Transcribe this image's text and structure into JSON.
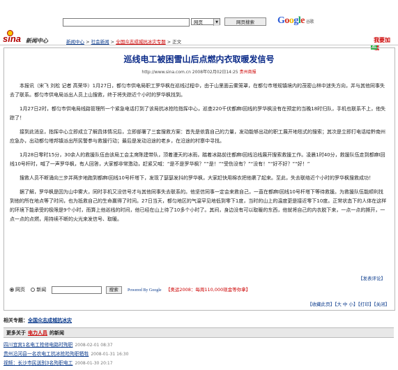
{
  "search": {
    "input_value": "",
    "select_value": "网页",
    "button_label": "网页搜索",
    "google_sub": "谷歌"
  },
  "nav": {
    "logo": "sina",
    "news_center": "新闻中心",
    "breadcrumb": [
      "新闻中心",
      "社会新闻",
      "全国众志成城抗冰灾专题",
      "正文"
    ],
    "collect_label": "我要加载"
  },
  "article": {
    "headline": "巡线电工被困雪山后点燃内衣取暖发信号",
    "url": "http://www.sina.com.cn",
    "datetime": "2008年02月02日14:25",
    "source": "贵州商报",
    "paragraphs": [
      "本报讯（宋飞 刘松 记者 高荣华）1月27日，都匀市供电局职工罗华枫在巡线过程中，由于山里面云雾笼罩，在都匀市塔规镇境内的茂密山林中迷失方向，并与其他同事失去了联系。都匀市供电局派出人员上山搜救，终于将失踪近个小时的罗华枫找到。",
      "1月27日2时，都匀市供电局线路管理所一个紧急电话打到了该局抗冰抢险指挥中心，巡查220千伏都麻Ⅰ回线的罗华枫没有在预定的当晚18时归队，手机也联系不上，他失踪了！",
      "接到此消息，指挥中心立即成立了解具体情况后，立即部署了三套搜救方案：首先是依靠自己的力量，发动能够出动的职工展开地毯式的搜索；其次是立即打电话给黔南州应急办，出动都匀塔邦镇派出所民警参与救援行动；最后是发动沿途的老乡，在沿途的村寨中寻找。",
      "1月28日零时15分，30余人的救援队伍由该局工会主席陈建带队，顶着漫天的冰雨，踏着冰路前往都麻Ⅰ回线沿线展开搜索救援工作。凌晨1时40分，救援队伍走到都麻Ⅰ回线10号杆时，喊了一声罗华枫，有人回答，大家都非常激动，赶紧又喊：“是不是罗华枫？”“是！”“受伤没有？”“没有！”“好不好？”“好！”",
      "搜救人员不断涌向三步并两步地跑到都麻Ⅰ回线10号杆塔下，发现了瑟瑟发抖的罗华枫，大家赶快用棉衣把他裹了起来。至此，失去联络近个小时的罗华枫搜救成功！",
      "据了解，罗华枫是因为山中雾大，同时手机又没信号才与其他同事失去联系的。他坚信同事一定会来救自己，一直在都麻Ⅰ回线10号杆塔下等待救援。为救援队伍能顺利找到他的所在地点等了时间，也为抵救自己的生命赢得了时间。27日当天，都匀地区的气温罕见地低到零下1度，当时的山上的温度更是接近零下10度。正常状态下的人体在这样的环境下能承受的极限是9个小时，而算上他巡线的时间，他已经在山上待了10多个小时了。其间，身边没有可以取暖的东西，他就将自己的内衣脱下来，一点一点的撕开，一点一点的点燃，用持续不断的火光来发信号、取暖。"
    ],
    "discuss": "【发表评论】"
  },
  "bottom": {
    "radio_web": "网页",
    "radio_news": "新闻",
    "search_button": "搜索",
    "powered": "Powered By Google",
    "promo": "【奥运2008：每周110,000现金等你拿】",
    "tools": [
      "收藏此页",
      "大",
      "中",
      "小",
      "打印",
      "关闭"
    ]
  },
  "related": {
    "label": "相关专题：",
    "topic": "全国众志成城抗冰灾",
    "more_prefix": "更多关于",
    "more_keyword": "电力人员",
    "more_suffix": "的新闻",
    "items": [
      {
        "title": "四川宜宾1名电工抢修电路时殉职",
        "date": "2008-02-01 08:37"
      },
      {
        "title": "贵州沿河县一名农电工抗冰抢险殉职牺牲",
        "date": "2008-01-31 16:30"
      },
      {
        "title": "视频：长沙市民送别3名殉职电工",
        "date": "2008-01-30 20:17"
      }
    ]
  }
}
